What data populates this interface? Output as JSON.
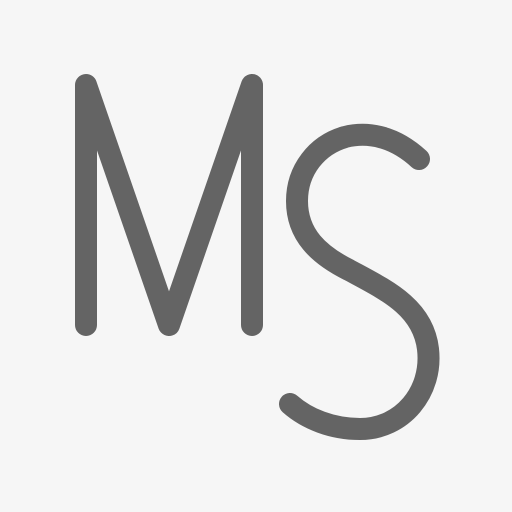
{
  "logo": {
    "text": "Ms",
    "letters": [
      "M",
      "s"
    ],
    "color": "#646464",
    "background": "#f6f6f6"
  }
}
